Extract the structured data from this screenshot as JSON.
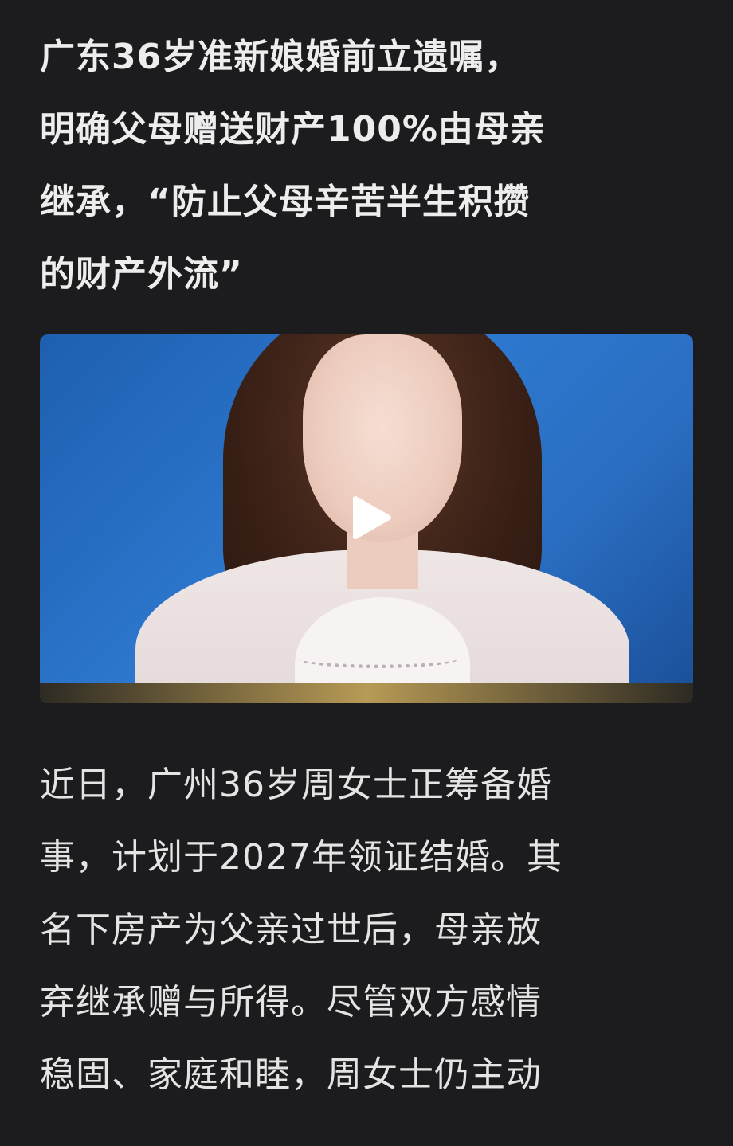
{
  "headline": {
    "lines": [
      "广东36岁准新娘婚前立遗嘱，",
      "明确父母赠送财产100%由母亲",
      "继承，“防止父母辛苦半生积攒",
      "的财产外流”"
    ]
  },
  "video": {
    "play_icon": "play-icon"
  },
  "body": {
    "lines": [
      "近日，广州36岁周女士正筹备婚",
      "事，计划于2027年领证结婚。其",
      "名下房产为父亲过世后，母亲放",
      "弃继承赠与所得。尽管双方感情",
      "稳固、家庭和睦，周女士仍主动"
    ]
  },
  "colors": {
    "background": "#1c1c1e",
    "text": "#ececec",
    "video_bg": "#2d78cf"
  }
}
